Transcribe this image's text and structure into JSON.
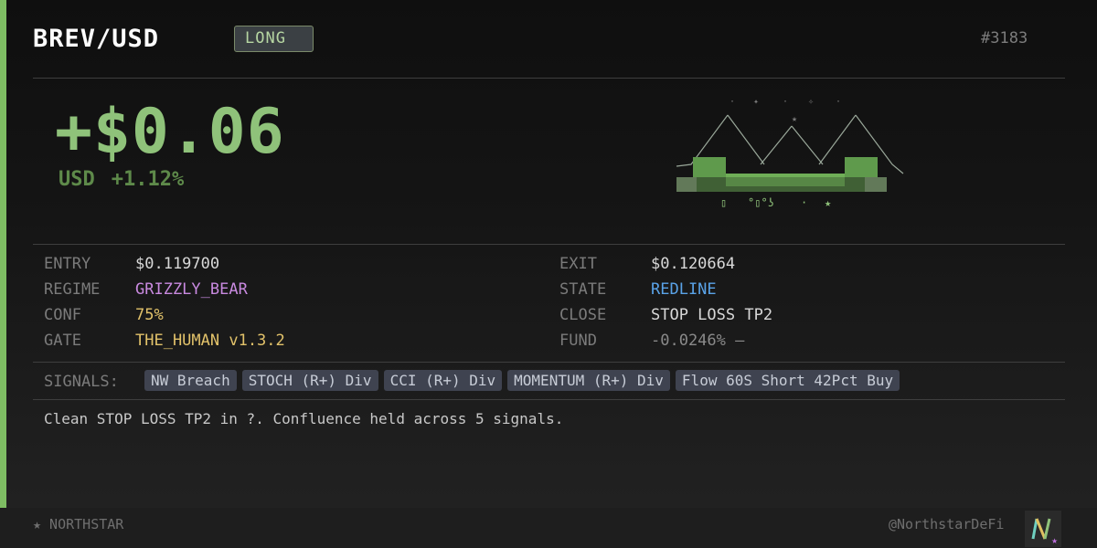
{
  "header": {
    "pair": "BREV/USD",
    "side": "LONG",
    "trade_id": "#3183"
  },
  "pnl": {
    "amount": "+$0.06",
    "currency": "USD",
    "percent": "+1.12%"
  },
  "details": {
    "left": [
      {
        "label": "ENTRY",
        "value": "$0.119700",
        "color": "#d8d8d8"
      },
      {
        "label": "REGIME",
        "value": "GRIZZLY_BEAR",
        "color": "#c98ae0"
      },
      {
        "label": "CONF",
        "value": "75%",
        "color": "#e2c26a"
      },
      {
        "label": "GATE",
        "value": "THE_HUMAN v1.3.2",
        "color": "#e2c26a"
      }
    ],
    "right": [
      {
        "label": "EXIT",
        "value": "$0.120664",
        "color": "#d8d8d8"
      },
      {
        "label": "STATE",
        "value": "REDLINE",
        "color": "#5aa3e8"
      },
      {
        "label": "CLOSE",
        "value": "STOP LOSS TP2",
        "color": "#d8d8d8"
      },
      {
        "label": "FUND",
        "value": "-0.0246% —",
        "color": "#8a8a8a"
      }
    ]
  },
  "signals": {
    "label": "SIGNALS:",
    "items": [
      "NW Breach",
      "STOCH (R+) Div",
      "CCI (R+) Div",
      "MOMENTUM (R+) Div",
      "Flow 60S Short 42Pct Buy"
    ]
  },
  "summary": "Clean STOP LOSS TP2 in ?. Confluence held across 5 signals.",
  "footer": {
    "brand": "★ NORTHSTAR",
    "handle": "@NorthstarDeFi"
  },
  "colors": {
    "accent": "#7ebd63",
    "pnl_green": "#8fc27a"
  }
}
